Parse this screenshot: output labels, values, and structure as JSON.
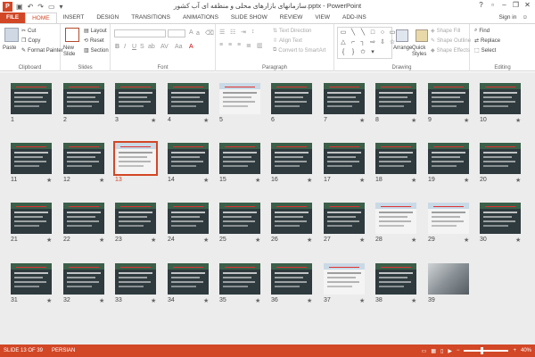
{
  "titlebar": {
    "app_icon": "P",
    "title": "سازمانهای بازارهای محلی و منطقه ای آب کشور.pptx - PowerPoint",
    "help": "?",
    "minimize": "–",
    "restore": "❐",
    "close": "✕"
  },
  "tabs": {
    "file": "FILE",
    "items": [
      "HOME",
      "INSERT",
      "DESIGN",
      "TRANSITIONS",
      "ANIMATIONS",
      "SLIDE SHOW",
      "REVIEW",
      "VIEW",
      "ADD-INS"
    ],
    "signin": "Sign in"
  },
  "ribbon": {
    "clipboard": {
      "paste": "Paste",
      "cut": "Cut",
      "copy": "Copy",
      "format_painter": "Format Painter",
      "label": "Clipboard"
    },
    "slides": {
      "new_slide": "New Slide",
      "layout": "Layout",
      "reset": "Reset",
      "section": "Section",
      "label": "Slides"
    },
    "font": {
      "label": "Font"
    },
    "paragraph": {
      "text_direction": "Text Direction",
      "align_text": "Align Text",
      "convert_smartart": "Convert to SmartArt",
      "label": "Paragraph"
    },
    "drawing": {
      "arrange": "Arrange",
      "quick_styles": "Quick Styles",
      "shape_fill": "Shape Fill",
      "shape_outline": "Shape Outline",
      "shape_effects": "Shape Effects",
      "label": "Drawing"
    },
    "editing": {
      "find": "Find",
      "replace": "Replace",
      "select": "Select",
      "label": "Editing"
    }
  },
  "slides": [
    {
      "n": "1",
      "star": false,
      "style": "dark"
    },
    {
      "n": "2",
      "star": false,
      "style": "dark"
    },
    {
      "n": "3",
      "star": true,
      "style": "dark"
    },
    {
      "n": "4",
      "star": true,
      "style": "dark"
    },
    {
      "n": "5",
      "star": false,
      "style": "light"
    },
    {
      "n": "6",
      "star": false,
      "style": "dark"
    },
    {
      "n": "7",
      "star": true,
      "style": "dark"
    },
    {
      "n": "8",
      "star": true,
      "style": "dark"
    },
    {
      "n": "9",
      "star": true,
      "style": "dark"
    },
    {
      "n": "10",
      "star": true,
      "style": "dark"
    },
    {
      "n": "11",
      "star": true,
      "style": "dark"
    },
    {
      "n": "12",
      "star": true,
      "style": "dark"
    },
    {
      "n": "13",
      "star": false,
      "style": "light",
      "selected": true
    },
    {
      "n": "14",
      "star": true,
      "style": "dark"
    },
    {
      "n": "15",
      "star": true,
      "style": "dark"
    },
    {
      "n": "16",
      "star": true,
      "style": "dark"
    },
    {
      "n": "17",
      "star": true,
      "style": "dark"
    },
    {
      "n": "18",
      "star": true,
      "style": "dark"
    },
    {
      "n": "19",
      "star": true,
      "style": "dark"
    },
    {
      "n": "20",
      "star": true,
      "style": "dark"
    },
    {
      "n": "21",
      "star": true,
      "style": "dark"
    },
    {
      "n": "22",
      "star": true,
      "style": "dark"
    },
    {
      "n": "23",
      "star": true,
      "style": "dark"
    },
    {
      "n": "24",
      "star": true,
      "style": "dark"
    },
    {
      "n": "25",
      "star": true,
      "style": "dark"
    },
    {
      "n": "26",
      "star": true,
      "style": "dark"
    },
    {
      "n": "27",
      "star": true,
      "style": "dark"
    },
    {
      "n": "28",
      "star": true,
      "style": "light"
    },
    {
      "n": "29",
      "star": true,
      "style": "light"
    },
    {
      "n": "30",
      "star": true,
      "style": "dark"
    },
    {
      "n": "31",
      "star": true,
      "style": "dark"
    },
    {
      "n": "32",
      "star": true,
      "style": "dark"
    },
    {
      "n": "33",
      "star": true,
      "style": "dark"
    },
    {
      "n": "34",
      "star": true,
      "style": "dark"
    },
    {
      "n": "35",
      "star": true,
      "style": "dark"
    },
    {
      "n": "36",
      "star": true,
      "style": "dark"
    },
    {
      "n": "37",
      "star": true,
      "style": "light"
    },
    {
      "n": "38",
      "star": true,
      "style": "dark"
    },
    {
      "n": "39",
      "star": false,
      "style": "photo"
    }
  ],
  "star_glyph": "★",
  "status": {
    "slide_info": "SLIDE 13 OF 39",
    "language": "PERSIAN",
    "zoom": "40%",
    "zoom_minus": "−",
    "zoom_plus": "+",
    "zoom_level": 0.4
  },
  "colors": {
    "accent": "#d24726"
  }
}
